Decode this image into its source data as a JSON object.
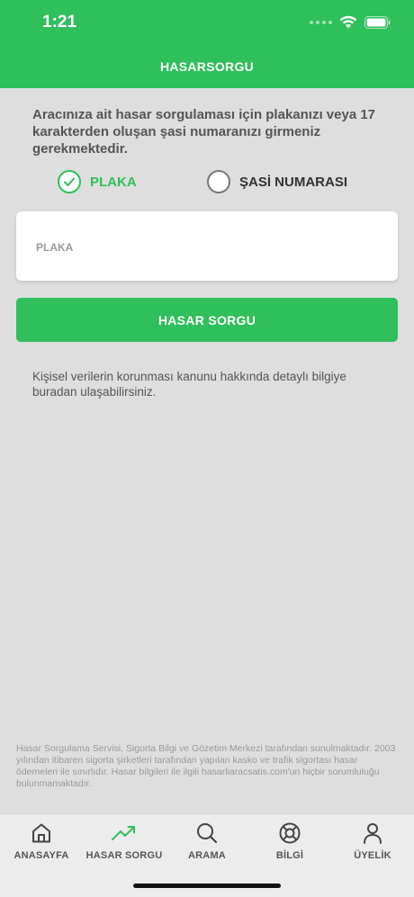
{
  "status": {
    "time": "1:21"
  },
  "header": {
    "title": "HASARSORGU"
  },
  "description": "Aracınıza ait hasar sorgulaması için plakanızı veya 17 karakterden oluşan şasi numaranızı girmeniz gerekmektedir.",
  "options": [
    {
      "label": "PLAKA",
      "selected": true
    },
    {
      "label": "ŞASİ NUMARASI",
      "selected": false
    }
  ],
  "input": {
    "placeholder": "PLAKA",
    "value": ""
  },
  "submit_label": "HASAR SORGU",
  "privacy_text": "Kişisel verilerin korunması kanunu hakkında detaylı bilgiye buradan ulaşabilirsiniz.",
  "disclaimer": "Hasar Sorgulama Servisi, Sigorta Bilgi ve Gözetim Merkezi tarafından sunulmaktadır. 2003 yılından itibaren sigorta şirketleri tarafından yapılan kasko ve trafik sigortası hasar ödemeleri ile sınırlıdır. Hasar bilgileri ile ilgili hasarliaracsatis.com'un hiçbir sorumluluğu bulunmamaktadır.",
  "tabs": [
    {
      "label": "ANASAYFA",
      "icon": "home-icon"
    },
    {
      "label": "HASAR SORGU",
      "icon": "trending-up-icon"
    },
    {
      "label": "ARAMA",
      "icon": "search-icon"
    },
    {
      "label": "BİLGİ",
      "icon": "lifebuoy-icon"
    },
    {
      "label": "ÜYELİK",
      "icon": "user-icon"
    }
  ],
  "colors": {
    "accent": "#2fbf5b",
    "background": "#dedede"
  }
}
